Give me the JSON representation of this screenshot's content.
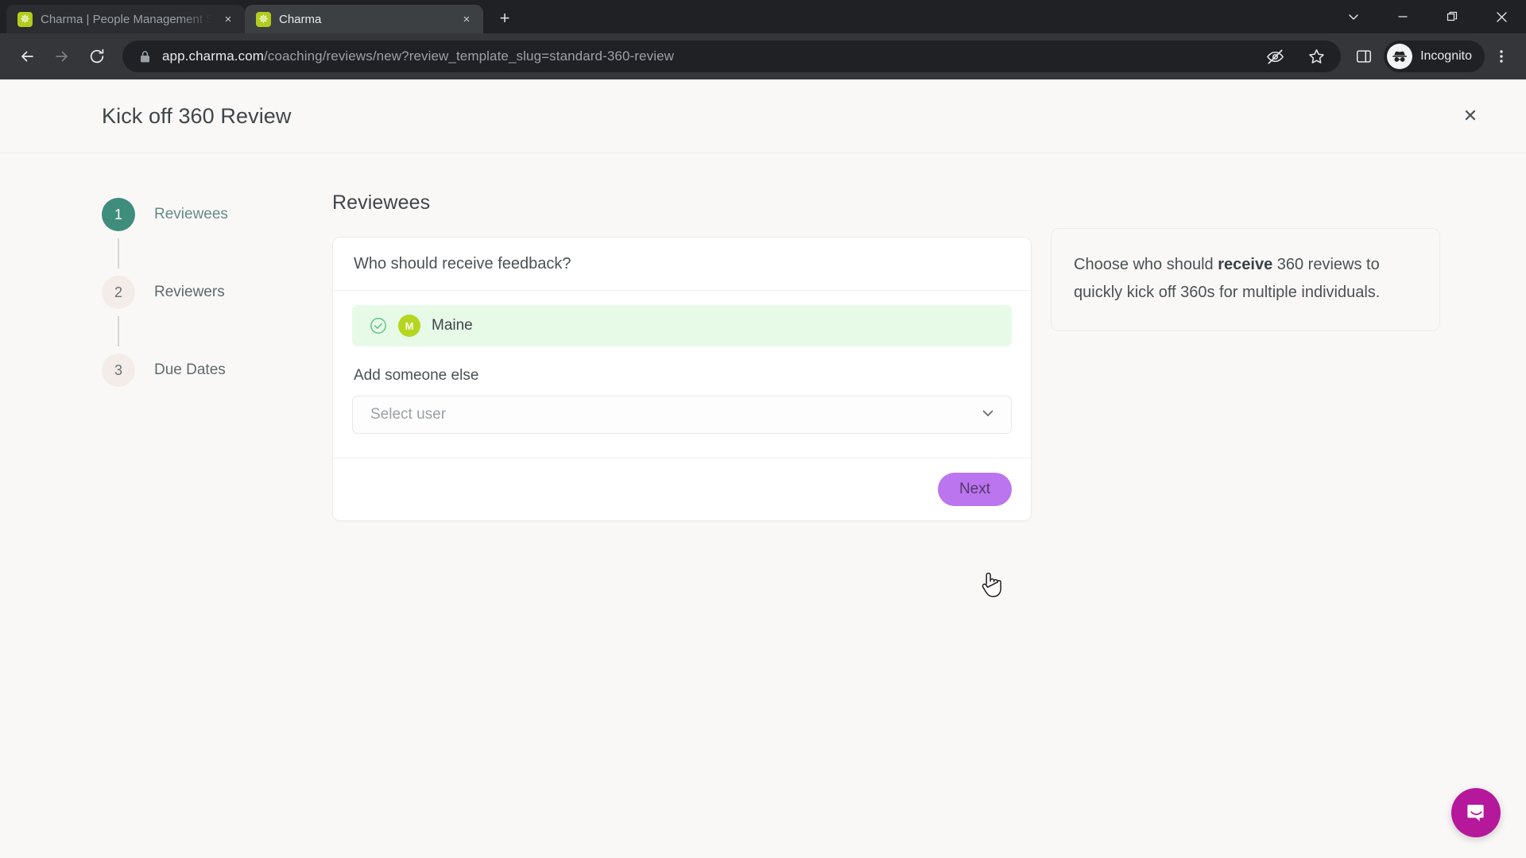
{
  "browser": {
    "tabs": [
      {
        "title": "Charma | People Management S",
        "favicon": "charma-star-icon",
        "active": false,
        "close_label": "×"
      },
      {
        "title": "Charma",
        "favicon": "charma-star-icon",
        "active": true,
        "close_label": "×"
      }
    ],
    "new_tab_label": "+",
    "window_controls": {
      "tab_search": "tab-search-icon",
      "minimize": "minimize-icon",
      "maximize": "maximize-icon",
      "close": "close-icon"
    },
    "toolbar": {
      "back": "back-arrow-icon",
      "forward": "forward-arrow-icon",
      "reload": "reload-icon",
      "lock": "lock-icon",
      "url_domain": "app.charma.com",
      "url_path": "/coaching/reviews/new?review_template_slug=standard-360-review",
      "url_full": "app.charma.com/coaching/reviews/new?review_template_slug=standard-360-review",
      "tracking_protection": "eye-slash-icon",
      "bookmark": "star-icon",
      "side_panel": "side-panel-icon",
      "profile_label": "Incognito",
      "menu": "kebab-menu-icon"
    }
  },
  "modal": {
    "title": "Kick off 360 Review",
    "close_label": "✕"
  },
  "stepper": {
    "steps": [
      {
        "number": "1",
        "label": "Reviewees",
        "state": "active"
      },
      {
        "number": "2",
        "label": "Reviewers",
        "state": "idle"
      },
      {
        "number": "3",
        "label": "Due Dates",
        "state": "idle"
      }
    ]
  },
  "main": {
    "heading": "Reviewees",
    "question": "Who should receive feedback?",
    "reviewees": [
      {
        "name": "Maine",
        "initial": "M",
        "selected": true,
        "avatar_color": "#b5d61e"
      }
    ],
    "add_label": "Add someone else",
    "select_user_placeholder": "Select user",
    "next_label": "Next"
  },
  "helper": {
    "text_before": "Choose who should ",
    "text_bold": "receive",
    "text_after": " 360 reviews to quickly kick off 360s for multiple individuals."
  },
  "widgets": {
    "intercom_label": "intercom-chat-bubble"
  },
  "colors": {
    "accent_teal": "#3f8d7d",
    "accent_purple": "#bb75ee",
    "avatar_green": "#b5d61e",
    "selected_row": "#e7fae8",
    "page_bg": "#faf8f7",
    "intercom_magenta": "#b5189b"
  }
}
